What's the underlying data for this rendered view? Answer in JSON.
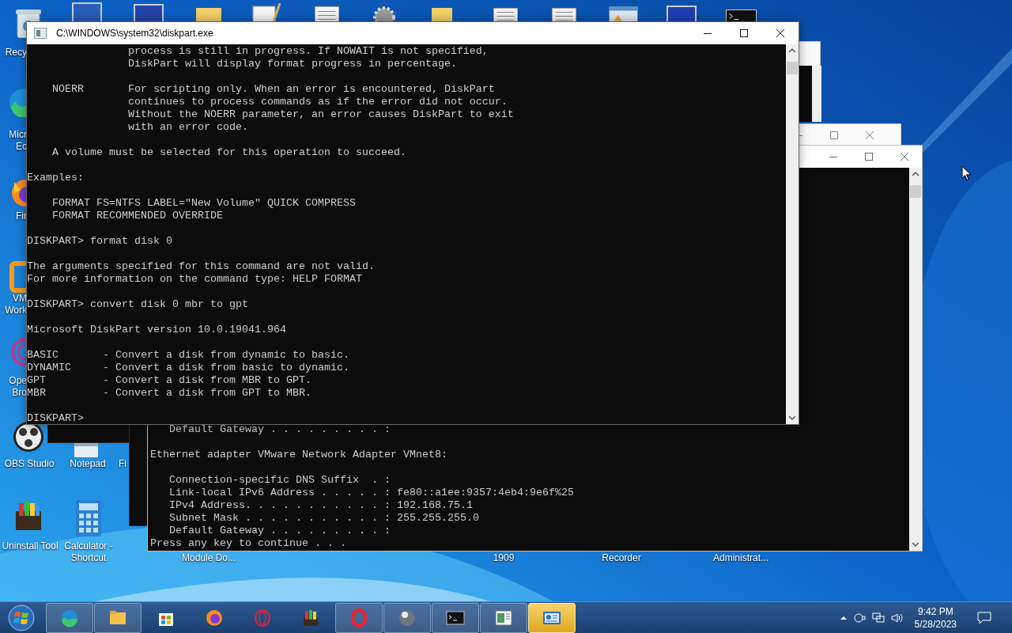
{
  "desktop_icons": [
    {
      "lines": [
        "Recy"
      ]
    },
    {
      "lines": [
        "Micr",
        "Ec"
      ]
    },
    {
      "lines": [
        "Fir"
      ]
    },
    {
      "lines": [
        "VM",
        "Work"
      ]
    },
    {
      "lines": [
        "Ope",
        "Bro"
      ]
    },
    {
      "lines": [
        "OBS Studio"
      ]
    },
    {
      "lines": [
        "Notepad"
      ]
    },
    {
      "lines": [
        "Fi"
      ]
    },
    {
      "lines": [
        "Uninstall Tool"
      ]
    },
    {
      "lines": [
        "Calculator -",
        "Shortcut"
      ]
    },
    {
      "lines": [
        "Module Do..."
      ]
    },
    {
      "lines": [
        "1909"
      ]
    },
    {
      "lines": [
        "Recorder"
      ]
    },
    {
      "lines": [
        "Administrat..."
      ]
    }
  ],
  "ipconfig_window": {
    "lines": [
      "   Default Gateway . . . . . . . . . :",
      "Ethernet adapter VMware Network Adapter VMnet8:",
      "   Connection-specific DNS Suffix  . :\n   Link-local IPv6 Address . . . . . : fe80::a1ee:9357:4eb4:9e6f%25\n   IPv4 Address. . . . . . . . . . . : 192.168.75.1\n   Subnet Mask . . . . . . . . . . . : 255.255.255.0\n   Default Gateway . . . . . . . . . :\nPress any key to continue . . ."
    ]
  },
  "diskpart_window": {
    "title": "C:\\WINDOWS\\system32\\diskpart.exe",
    "blocks": [
      "                process is still in progress. If NOWAIT is not specified,\n                DiskPart will display format progress in percentage.",
      "    NOERR       For scripting only. When an error is encountered, DiskPart\n                continues to process commands as if the error did not occur.\n                Without the NOERR parameter, an error causes DiskPart to exit\n                with an error code.",
      "    A volume must be selected for this operation to succeed.",
      "Examples:",
      "    FORMAT FS=NTFS LABEL=\"New Volume\" QUICK COMPRESS\n    FORMAT RECOMMENDED OVERRIDE",
      "DISKPART> format disk 0",
      "The arguments specified for this command are not valid.\nFor more information on the command type: HELP FORMAT",
      "DISKPART> convert disk 0 mbr to gpt",
      "Microsoft DiskPart version 10.0.19041.964",
      "BASIC       - Convert a disk from dynamic to basic.\nDYNAMIC     - Convert a disk from basic to dynamic.\nGPT         - Convert a disk from MBR to GPT.\nMBR         - Convert a disk from GPT to MBR.",
      "DISKPART>"
    ]
  },
  "taskbar": {
    "buttons": [
      {
        "running": true,
        "selected": false
      },
      {
        "running": true,
        "selected": false
      },
      {
        "running": false,
        "selected": false
      },
      {
        "running": false,
        "selected": false
      },
      {
        "running": false,
        "selected": false
      },
      {
        "running": false,
        "selected": false
      },
      {
        "running": true,
        "selected": false
      },
      {
        "running": true,
        "selected": false
      },
      {
        "running": true,
        "selected": false
      },
      {
        "running": true,
        "selected": false
      },
      {
        "running": true,
        "selected": true
      }
    ],
    "clock": {
      "time": "9:42 PM",
      "date": "5/28/2023"
    }
  }
}
